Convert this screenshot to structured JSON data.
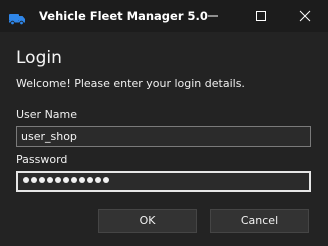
{
  "window": {
    "title": "Vehicle Fleet Manager 5.0",
    "app_icon": "truck-icon",
    "controls": {
      "minimize_icon": "minimize-icon",
      "maximize_icon": "maximize-icon",
      "close_icon": "close-icon"
    }
  },
  "form": {
    "heading": "Login",
    "welcome": "Welcome! Please enter your login details.",
    "username_label": "User Name",
    "username_value": "user_shop",
    "password_label": "Password",
    "password_mask_length": 11
  },
  "buttons": {
    "ok_label": "OK",
    "cancel_label": "Cancel"
  },
  "colors": {
    "background": "#232323",
    "titlebar": "#1c1c1c",
    "text": "#f2f2f2",
    "icon_blue": "#2f86e8",
    "field_border": "#7a7a7a",
    "focus_border": "#e6e6e6",
    "button_bg": "#333333"
  }
}
